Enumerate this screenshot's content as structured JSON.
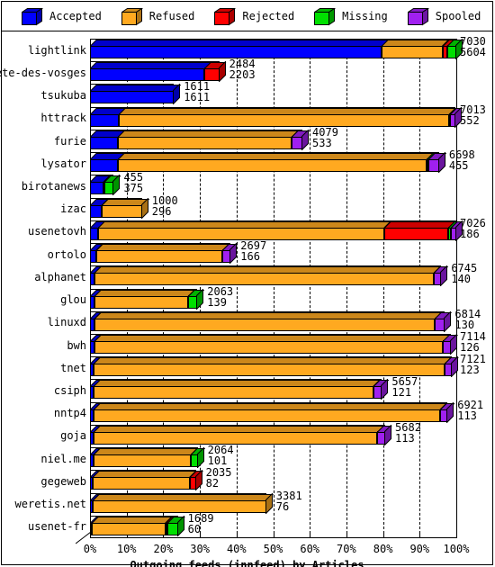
{
  "legend": {
    "items": [
      {
        "label": "Accepted",
        "color": "#0000ff",
        "icon": "cube-icon"
      },
      {
        "label": "Refused",
        "color": "#ffa920",
        "icon": "cube-icon"
      },
      {
        "label": "Rejected",
        "color": "#ff0000",
        "icon": "cube-icon"
      },
      {
        "label": "Missing",
        "color": "#00e000",
        "icon": "cube-icon"
      },
      {
        "label": "Spooled",
        "color": "#a020f0",
        "icon": "cube-icon"
      }
    ]
  },
  "axis": {
    "title": "Outgoing feeds (innfeed) by Articles",
    "ticks": [
      "0%",
      "10%",
      "20%",
      "30%",
      "40%",
      "50%",
      "60%",
      "70%",
      "80%",
      "90%",
      "100%"
    ]
  },
  "chart_data": {
    "type": "bar",
    "orientation": "horizontal",
    "stacked": true,
    "title": "Outgoing feeds (innfeed) by Articles",
    "xlabel": "Outgoing feeds (innfeed) by Articles",
    "ylabel": "",
    "xlim": [
      0,
      100
    ],
    "xtick_labels": [
      "0%",
      "10%",
      "20%",
      "30%",
      "40%",
      "50%",
      "60%",
      "70%",
      "80%",
      "90%",
      "100%"
    ],
    "grid": true,
    "legend_position": "top",
    "series": [
      {
        "name": "Accepted",
        "color": "#0000ff"
      },
      {
        "name": "Refused",
        "color": "#ffa920"
      },
      {
        "name": "Rejected",
        "color": "#ff0000"
      },
      {
        "name": "Missing",
        "color": "#00e000"
      },
      {
        "name": "Spooled",
        "color": "#a020f0"
      }
    ],
    "categories": [
      "lightlink",
      "bete-des-vosges",
      "tsukuba",
      "httrack",
      "furie",
      "lysator",
      "birotanews",
      "izac",
      "usenetovh",
      "ortolo",
      "alphanet",
      "glou",
      "linuxd",
      "bwh",
      "tnet",
      "csiph",
      "nntp4",
      "goja",
      "niel.me",
      "gegeweb",
      "weretis.net",
      "usenet-fr"
    ],
    "rows": [
      {
        "label": "lightlink",
        "total": 7030,
        "value2": 5604,
        "pct_total": 100.0,
        "segments": [
          {
            "name": "Accepted",
            "pct": 79.7
          },
          {
            "name": "Refused",
            "pct": 16.5
          },
          {
            "name": "Rejected",
            "pct": 1.3
          },
          {
            "name": "Missing",
            "pct": 2.5
          }
        ]
      },
      {
        "label": "bete-des-vosges",
        "total": 2484,
        "value2": 2203,
        "pct_total": 35.3,
        "segments": [
          {
            "name": "Accepted",
            "pct": 31.3
          },
          {
            "name": "Rejected",
            "pct": 4.0
          }
        ]
      },
      {
        "label": "tsukuba",
        "total": 1611,
        "value2": 1611,
        "pct_total": 22.9,
        "segments": [
          {
            "name": "Accepted",
            "pct": 22.9
          }
        ]
      },
      {
        "label": "httrack",
        "total": 7013,
        "value2": 552,
        "pct_total": 99.8,
        "segments": [
          {
            "name": "Accepted",
            "pct": 7.9
          },
          {
            "name": "Refused",
            "pct": 90.1
          },
          {
            "name": "Missing",
            "pct": 0.3
          },
          {
            "name": "Spooled",
            "pct": 1.5
          }
        ]
      },
      {
        "label": "furie",
        "total": 4079,
        "value2": 533,
        "pct_total": 58.0,
        "segments": [
          {
            "name": "Accepted",
            "pct": 7.6
          },
          {
            "name": "Refused",
            "pct": 47.4
          },
          {
            "name": "Spooled",
            "pct": 3.0
          }
        ]
      },
      {
        "label": "lysator",
        "total": 6698,
        "value2": 455,
        "pct_total": 95.3,
        "segments": [
          {
            "name": "Accepted",
            "pct": 7.6
          },
          {
            "name": "Refused",
            "pct": 84.3
          },
          {
            "name": "Missing",
            "pct": 0.4
          },
          {
            "name": "Spooled",
            "pct": 3.0
          }
        ]
      },
      {
        "label": "birotanews",
        "total": 455,
        "value2": 375,
        "pct_total": 6.5,
        "segments": [
          {
            "name": "Accepted",
            "pct": 3.6
          },
          {
            "name": "Refused",
            "pct": 0.3
          },
          {
            "name": "Missing",
            "pct": 2.6
          }
        ]
      },
      {
        "label": "izac",
        "total": 1000,
        "value2": 296,
        "pct_total": 14.2,
        "segments": [
          {
            "name": "Accepted",
            "pct": 3.1
          },
          {
            "name": "Refused",
            "pct": 11.1
          }
        ]
      },
      {
        "label": "usenetovh",
        "total": 7026,
        "value2": 186,
        "pct_total": 99.9,
        "segments": [
          {
            "name": "Accepted",
            "pct": 2.3
          },
          {
            "name": "Refused",
            "pct": 78.0
          },
          {
            "name": "Rejected",
            "pct": 17.5
          },
          {
            "name": "Missing",
            "pct": 0.7
          },
          {
            "name": "Spooled",
            "pct": 1.4
          }
        ]
      },
      {
        "label": "ortolo",
        "total": 2697,
        "value2": 166,
        "pct_total": 38.4,
        "segments": [
          {
            "name": "Accepted",
            "pct": 1.6
          },
          {
            "name": "Refused",
            "pct": 34.4
          },
          {
            "name": "Spooled",
            "pct": 2.4
          }
        ]
      },
      {
        "label": "alphanet",
        "total": 6745,
        "value2": 140,
        "pct_total": 95.9,
        "segments": [
          {
            "name": "Accepted",
            "pct": 1.3
          },
          {
            "name": "Refused",
            "pct": 92.6
          },
          {
            "name": "Spooled",
            "pct": 2.0
          }
        ]
      },
      {
        "label": "glou",
        "total": 2063,
        "value2": 139,
        "pct_total": 29.3,
        "segments": [
          {
            "name": "Accepted",
            "pct": 1.3
          },
          {
            "name": "Refused",
            "pct": 25.5
          },
          {
            "name": "Missing",
            "pct": 2.5
          }
        ]
      },
      {
        "label": "linuxd",
        "total": 6814,
        "value2": 130,
        "pct_total": 96.9,
        "segments": [
          {
            "name": "Accepted",
            "pct": 1.2
          },
          {
            "name": "Refused",
            "pct": 93.0
          },
          {
            "name": "Spooled",
            "pct": 2.7
          }
        ]
      },
      {
        "label": "bwh",
        "total": 7114,
        "value2": 126,
        "pct_total": 101.2,
        "segments": [
          {
            "name": "Accepted",
            "pct": 1.2
          },
          {
            "name": "Refused",
            "pct": 95.2
          },
          {
            "name": "Spooled",
            "pct": 2.2
          }
        ]
      },
      {
        "label": "tnet",
        "total": 7121,
        "value2": 123,
        "pct_total": 101.3,
        "segments": [
          {
            "name": "Accepted",
            "pct": 1.1
          },
          {
            "name": "Refused",
            "pct": 95.8
          },
          {
            "name": "Spooled",
            "pct": 1.9
          }
        ]
      },
      {
        "label": "csiph",
        "total": 5657,
        "value2": 121,
        "pct_total": 80.5,
        "segments": [
          {
            "name": "Accepted",
            "pct": 1.1
          },
          {
            "name": "Refused",
            "pct": 76.3
          },
          {
            "name": "Spooled",
            "pct": 2.3
          }
        ]
      },
      {
        "label": "nntp4",
        "total": 6921,
        "value2": 113,
        "pct_total": 98.4,
        "segments": [
          {
            "name": "Accepted",
            "pct": 1.0
          },
          {
            "name": "Refused",
            "pct": 94.5
          },
          {
            "name": "Spooled",
            "pct": 2.1
          }
        ]
      },
      {
        "label": "goja",
        "total": 5682,
        "value2": 113,
        "pct_total": 80.8,
        "segments": [
          {
            "name": "Accepted",
            "pct": 1.0
          },
          {
            "name": "Refused",
            "pct": 77.5
          },
          {
            "name": "Spooled",
            "pct": 2.1
          }
        ]
      },
      {
        "label": "niel.me",
        "total": 2064,
        "value2": 101,
        "pct_total": 29.4,
        "segments": [
          {
            "name": "Accepted",
            "pct": 0.9
          },
          {
            "name": "Refused",
            "pct": 26.5
          },
          {
            "name": "Missing",
            "pct": 2.0
          }
        ]
      },
      {
        "label": "gegeweb",
        "total": 2035,
        "value2": 82,
        "pct_total": 28.9,
        "segments": [
          {
            "name": "Accepted",
            "pct": 0.8
          },
          {
            "name": "Refused",
            "pct": 26.4
          },
          {
            "name": "Rejected",
            "pct": 1.7
          }
        ]
      },
      {
        "label": "weretis.net",
        "total": 3381,
        "value2": 76,
        "pct_total": 48.1,
        "segments": [
          {
            "name": "Accepted",
            "pct": 0.7
          },
          {
            "name": "Refused",
            "pct": 47.4
          }
        ]
      },
      {
        "label": "usenet-fr",
        "total": 1689,
        "value2": 60,
        "pct_total": 24.0,
        "segments": [
          {
            "name": "Accepted",
            "pct": 0.6
          },
          {
            "name": "Refused",
            "pct": 20.0
          },
          {
            "name": "Rejected",
            "pct": 0.5
          },
          {
            "name": "Missing",
            "pct": 2.9
          }
        ]
      }
    ]
  }
}
